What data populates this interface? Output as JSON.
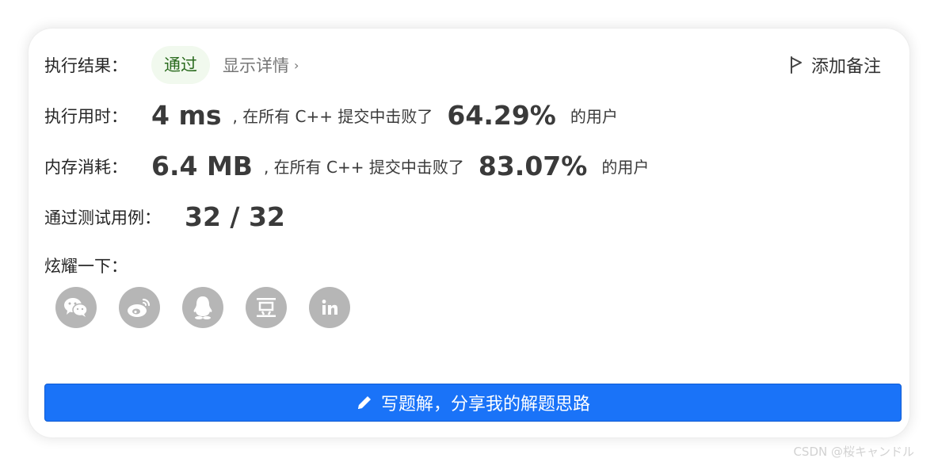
{
  "result": {
    "label": "执行结果：",
    "status": "通过",
    "details_link": "显示详情",
    "details_chevron": "›",
    "add_note": "添加备注"
  },
  "runtime": {
    "label": "执行用时：",
    "value": "4 ms",
    "mid_text": ", 在所有 C++ 提交中击败了",
    "percent": "64.29%",
    "suffix": "的用户"
  },
  "memory": {
    "label": "内存消耗：",
    "value": "6.4 MB",
    "mid_text": ", 在所有 C++ 提交中击败了",
    "percent": "83.07%",
    "suffix": "的用户"
  },
  "tests": {
    "label": "通过测试用例：",
    "value": "32 / 32"
  },
  "share": {
    "label": "炫耀一下：",
    "icons": [
      "wechat-icon",
      "weibo-icon",
      "qq-icon",
      "douban-icon",
      "linkedin-icon"
    ]
  },
  "cta": {
    "label": "写题解，分享我的解题思路"
  },
  "watermark": "CSDN @桜キャンドル",
  "colors": {
    "accent": "#1a73f8",
    "badge_bg": "#f1f9ee",
    "badge_text": "#2b6b1f",
    "icon_bg": "#b6b6b6"
  }
}
